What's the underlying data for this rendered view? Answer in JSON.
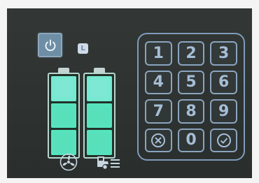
{
  "panel": {
    "status_badge": "L",
    "battery_left": {
      "level_segments": 3,
      "total_segments": 3
    },
    "battery_right": {
      "level_segments": 3,
      "total_segments": 3
    },
    "icons": [
      "power-icon",
      "fan-icon",
      "car-list-icon"
    ]
  },
  "keypad": {
    "keys": [
      "1",
      "2",
      "3",
      "4",
      "5",
      "6",
      "7",
      "8",
      "9",
      "cancel",
      "0",
      "confirm"
    ]
  },
  "colors": {
    "panel_bg": "#2c312f",
    "key_outline": "#8aa4bf",
    "battery_glow": "#58e0bb",
    "power_button": "#6d8ea4"
  }
}
